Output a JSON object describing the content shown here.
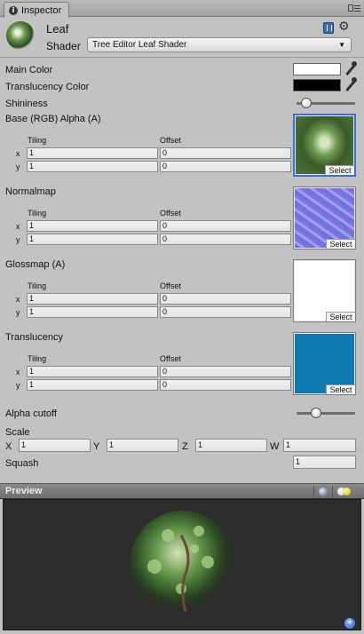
{
  "tab": {
    "label": "Inspector",
    "icon": "info-icon"
  },
  "header": {
    "asset_name": "Leaf",
    "shader_label": "Shader",
    "shader_value": "Tree Editor Leaf Shader",
    "icons": [
      "help-book-icon",
      "gear-icon"
    ]
  },
  "properties": {
    "main_color": {
      "label": "Main Color",
      "value": "#ffffff"
    },
    "translucency_color": {
      "label": "Translucency Color",
      "value": "#000000"
    },
    "shininess": {
      "label": "Shininess",
      "value": 0.1
    }
  },
  "textures": [
    {
      "label": "Base (RGB) Alpha (A)",
      "tiling_label": "Tiling",
      "offset_label": "Offset",
      "tiling": {
        "x": "1",
        "y": "1"
      },
      "offset": {
        "x": "0",
        "y": "0"
      },
      "select_label": "Select",
      "selected": true,
      "color": "#4a6b35"
    },
    {
      "label": "Normalmap",
      "tiling_label": "Tiling",
      "offset_label": "Offset",
      "tiling": {
        "x": "1",
        "y": "1"
      },
      "offset": {
        "x": "0",
        "y": "0"
      },
      "select_label": "Select",
      "selected": false,
      "color": "#7a82e8"
    },
    {
      "label": "Glossmap (A)",
      "tiling_label": "Tiling",
      "offset_label": "Offset",
      "tiling": {
        "x": "1",
        "y": "1"
      },
      "offset": {
        "x": "0",
        "y": "0"
      },
      "select_label": "Select",
      "selected": false,
      "color": "#ffffff"
    },
    {
      "label": "Translucency",
      "tiling_label": "Tiling",
      "offset_label": "Offset",
      "tiling": {
        "x": "1",
        "y": "1"
      },
      "offset": {
        "x": "0",
        "y": "0"
      },
      "select_label": "Select",
      "selected": false,
      "color": "#0e7ab0"
    }
  ],
  "alpha_cutoff": {
    "label": "Alpha cutoff",
    "value": 0.3
  },
  "scale": {
    "label": "Scale",
    "x_label": "X",
    "x": "1",
    "y_label": "Y",
    "y": "1",
    "z_label": "Z",
    "z": "1",
    "w_label": "W",
    "w": "1"
  },
  "squash": {
    "label": "Squash",
    "value": "1"
  },
  "axis_labels": {
    "x": "x",
    "y": "y"
  },
  "preview": {
    "title": "Preview",
    "icons": [
      "preview-sphere-icon",
      "preview-lights-icon",
      "add-icon"
    ]
  }
}
